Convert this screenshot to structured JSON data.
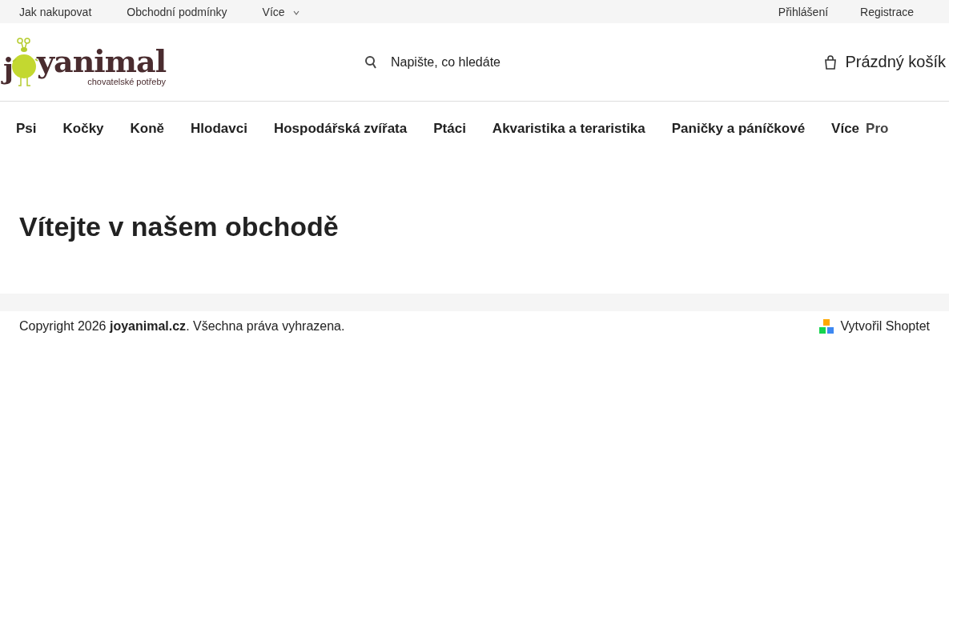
{
  "top_bar": {
    "links": [
      {
        "label": "Jak nakupovat",
        "kind": "link"
      },
      {
        "label": "Obchodní podmínky",
        "kind": "link"
      },
      {
        "label": "Více",
        "kind": "dropdown"
      }
    ],
    "account": [
      {
        "label": "Přihlášení"
      },
      {
        "label": "Registrace"
      }
    ]
  },
  "logo": {
    "first": "j",
    "rest": "yanimal",
    "tagline": "chovatelské potřeby"
  },
  "search": {
    "placeholder": "Napište, co hledáte"
  },
  "cart": {
    "label": "Prázdný košík"
  },
  "nav": [
    {
      "label": "Psi"
    },
    {
      "label": "Kočky"
    },
    {
      "label": "Koně"
    },
    {
      "label": "Hlodavci"
    },
    {
      "label": "Hospodářská zvířata"
    },
    {
      "label": "Ptáci"
    },
    {
      "label": "Akvaristika a teraristika"
    },
    {
      "label": "Paničky a páníčkové"
    },
    {
      "label": "Více"
    },
    {
      "label": "Pro"
    }
  ],
  "heading": "Vítejte v našem obchodě",
  "footer": {
    "copyright": "Copyright 2026 **joyanimal.cz**. Všechna práva vyhrazena.",
    "credit": "Vytvořil Shoptet"
  }
}
